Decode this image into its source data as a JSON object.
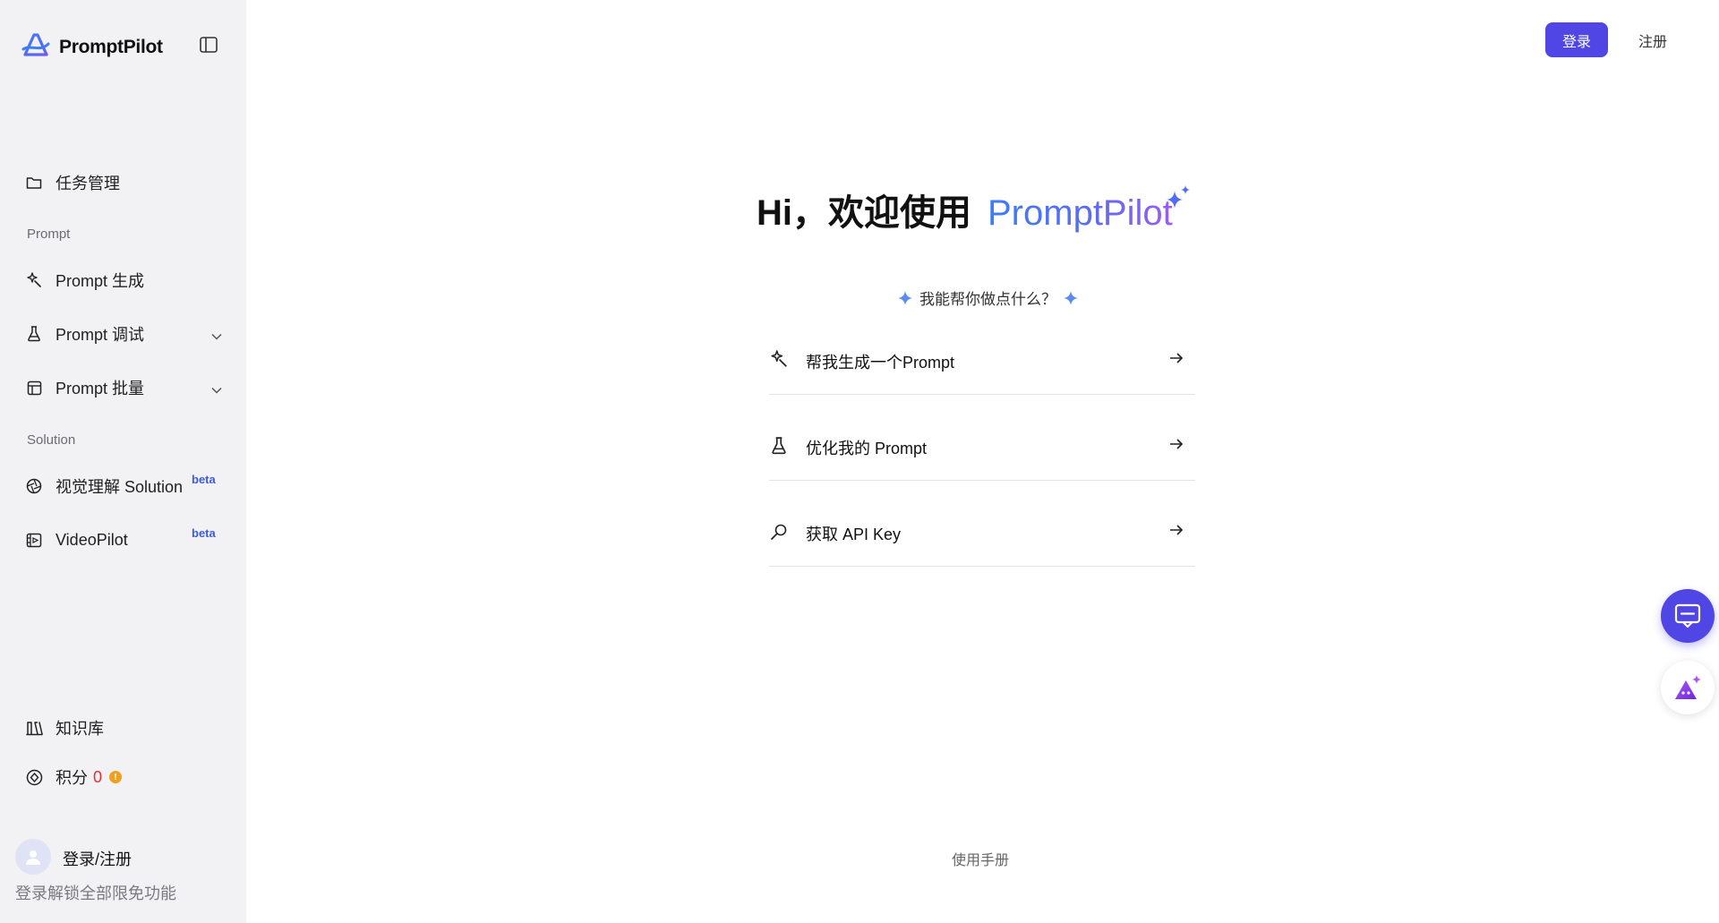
{
  "brand": {
    "name": "PromptPilot"
  },
  "sidebar": {
    "items": [
      {
        "label": "任务管理",
        "icon": "folder-icon"
      },
      {
        "label": "Prompt 生成",
        "icon": "magic-wand-icon"
      },
      {
        "label": "Prompt 调试",
        "icon": "flask-icon"
      },
      {
        "label": "Prompt 批量",
        "icon": "table-icon"
      },
      {
        "label": "视觉理解 Solution",
        "icon": "aperture-icon",
        "badge": "beta"
      },
      {
        "label": "VideoPilot",
        "icon": "film-icon",
        "badge": "beta"
      }
    ],
    "sections": {
      "prompt": "Prompt",
      "solution": "Solution"
    },
    "knowledge": "知识库",
    "points": {
      "label": "积分",
      "value": "0"
    },
    "user": {
      "login": "登录/注册",
      "sub": "登录解锁全部限免功能"
    }
  },
  "header": {
    "login": "登录",
    "register": "注册"
  },
  "main": {
    "greeting": "Hi，欢迎使用",
    "greeting_brand": "PromptPilot",
    "question": "我能帮你做点什么？",
    "actions": [
      {
        "label": "帮我生成一个Prompt",
        "icon": "magic-wand-icon"
      },
      {
        "label": "优化我的 Prompt",
        "icon": "flask-icon"
      },
      {
        "label": "获取 API Key",
        "icon": "key-search-icon"
      }
    ],
    "manual": "使用手册"
  },
  "colors": {
    "accent": "#4f46e5",
    "beta": "#3b5bdb",
    "sidebar_bg": "#f2f2f5",
    "points_value": "#e03131",
    "warn": "#f0a020"
  }
}
